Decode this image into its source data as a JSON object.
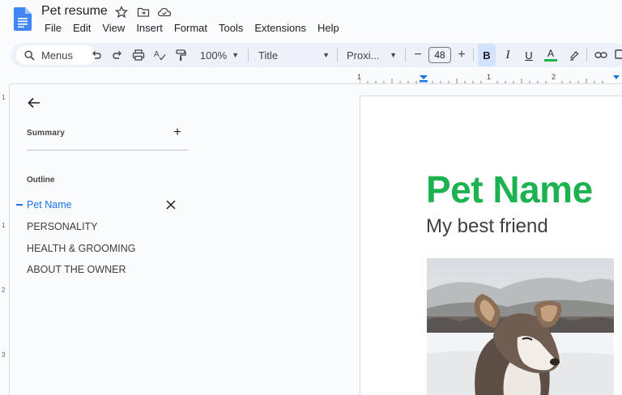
{
  "app": {
    "doc_title": "Pet resume",
    "menu": [
      "File",
      "Edit",
      "View",
      "Insert",
      "Format",
      "Tools",
      "Extensions",
      "Help"
    ]
  },
  "toolbar": {
    "search_label": "Menus",
    "zoom": "100%",
    "style": "Title",
    "font": "Proxi...",
    "font_size": "48"
  },
  "ruler": {
    "marks": [
      "1",
      "1",
      "2"
    ]
  },
  "vruler": {
    "marks": [
      "1",
      "1",
      "2",
      "3"
    ]
  },
  "outline_panel": {
    "summary_label": "Summary",
    "outline_label": "Outline",
    "items": [
      "Pet Name",
      "PERSONALITY",
      "HEALTH & GROOMING",
      "ABOUT THE OWNER"
    ]
  },
  "document": {
    "title": "Pet Name",
    "subtitle": "My best friend"
  },
  "colors": {
    "title_green": "#1db250",
    "accent_blue": "#1a73e8",
    "toolbar_bg": "#edf2fa"
  }
}
